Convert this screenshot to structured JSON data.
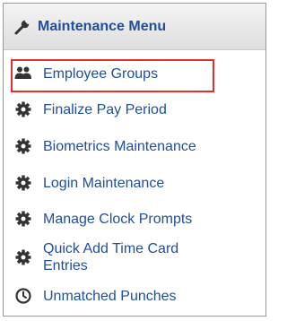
{
  "header": {
    "title": "Maintenance Menu",
    "icon": "wrench-icon"
  },
  "menu": {
    "items": [
      {
        "label": "Employee Groups",
        "icon": "users-icon",
        "highlighted": true
      },
      {
        "label": "Finalize Pay Period",
        "icon": "gear-icon"
      },
      {
        "label": "Biometrics Maintenance",
        "icon": "gear-icon"
      },
      {
        "label": "Login Maintenance",
        "icon": "gear-icon"
      },
      {
        "label": "Manage Clock Prompts",
        "icon": "gear-icon"
      },
      {
        "label_line1": "Quick Add Time Card",
        "label_line2": "Entries",
        "icon": "gear-icon"
      },
      {
        "label": "Unmatched Punches",
        "icon": "clock-icon"
      }
    ]
  },
  "colors": {
    "link": "#1f4e9e",
    "icon": "#333333",
    "highlight_border": "#e03030"
  }
}
